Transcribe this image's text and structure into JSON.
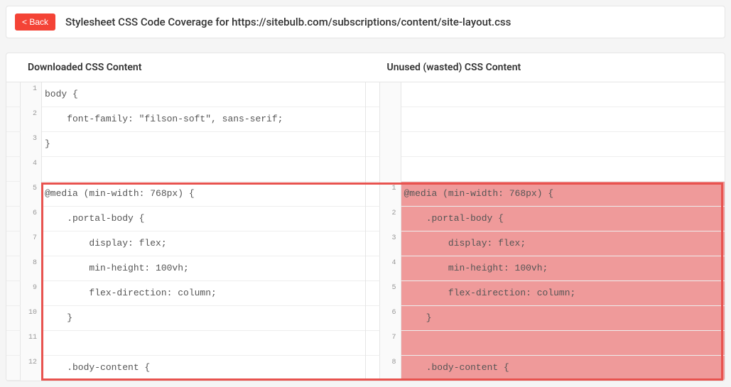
{
  "header": {
    "back_label": "< Back",
    "title": "Stylesheet CSS Code Coverage for https://sitebulb.com/subscriptions/content/site-layout.css"
  },
  "columns": {
    "left_header": "Downloaded CSS Content",
    "right_header": "Unused (wasted) CSS Content"
  },
  "left_lines": [
    {
      "num": "1",
      "text": "body {"
    },
    {
      "num": "2",
      "text": "    font-family: \"filson-soft\", sans-serif;"
    },
    {
      "num": "3",
      "text": "}"
    },
    {
      "num": "4",
      "text": ""
    },
    {
      "num": "5",
      "text": "@media (min-width: 768px) {"
    },
    {
      "num": "6",
      "text": "    .portal-body {"
    },
    {
      "num": "7",
      "text": "        display: flex;"
    },
    {
      "num": "8",
      "text": "        min-height: 100vh;"
    },
    {
      "num": "9",
      "text": "        flex-direction: column;"
    },
    {
      "num": "10",
      "text": "    }"
    },
    {
      "num": "11",
      "text": ""
    },
    {
      "num": "12",
      "text": "    .body-content {"
    }
  ],
  "right_lines": [
    {
      "num": "",
      "text": ""
    },
    {
      "num": "",
      "text": ""
    },
    {
      "num": "",
      "text": ""
    },
    {
      "num": "",
      "text": ""
    },
    {
      "num": "1",
      "text": "@media (min-width: 768px) {"
    },
    {
      "num": "2",
      "text": "    .portal-body {"
    },
    {
      "num": "3",
      "text": "        display: flex;"
    },
    {
      "num": "4",
      "text": "        min-height: 100vh;"
    },
    {
      "num": "5",
      "text": "        flex-direction: column;"
    },
    {
      "num": "6",
      "text": "    }"
    },
    {
      "num": "7",
      "text": ""
    },
    {
      "num": "8",
      "text": "    .body-content {"
    }
  ]
}
